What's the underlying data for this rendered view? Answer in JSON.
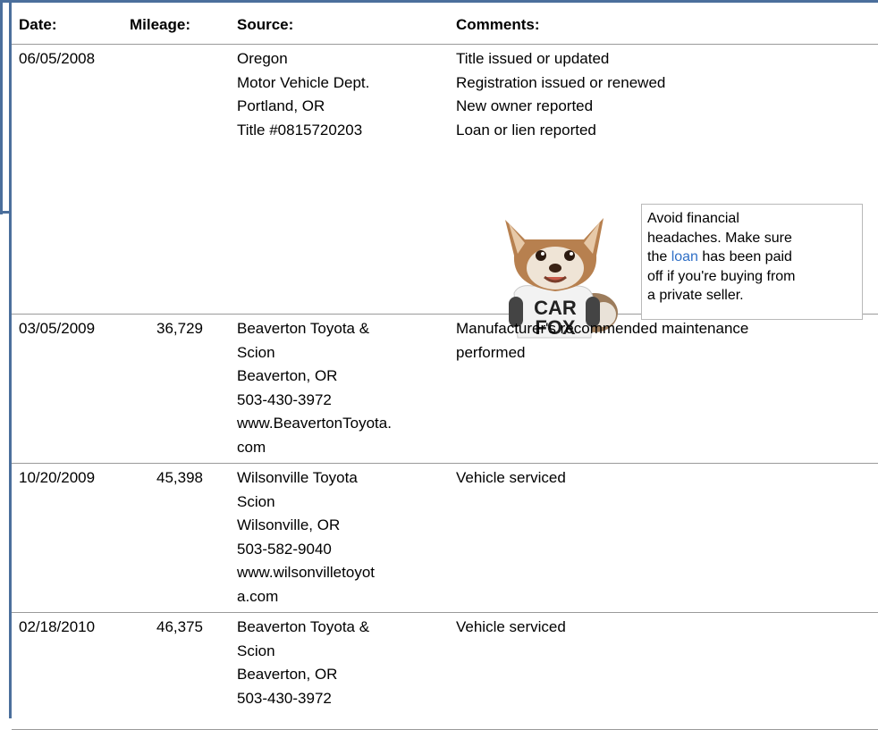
{
  "header": {
    "date": "Date:",
    "mileage": "Mileage:",
    "source": "Source:",
    "comments": "Comments:"
  },
  "rows": [
    {
      "date": "06/05/2008",
      "mileage": "",
      "source": [
        "Oregon",
        "Motor Vehicle Dept.",
        "Portland, OR",
        "Title #0815720203"
      ],
      "comments": [
        "Title issued or updated",
        "Registration issued or renewed",
        "New owner reported",
        "Loan or lien reported"
      ]
    },
    {
      "date": "03/05/2009",
      "mileage": "36,729",
      "source": [
        "Beaverton Toyota &",
        "Scion",
        "Beaverton, OR",
        "503-430-3972",
        "www.BeavertonToyota.",
        "com"
      ],
      "comments": [
        "Manufacturer's recommended maintenance",
        "performed"
      ]
    },
    {
      "date": "10/20/2009",
      "mileage": "45,398",
      "source": [
        "Wilsonville Toyota",
        "Scion",
        "Wilsonville, OR",
        "503-582-9040",
        "www.wilsonvilletoyot",
        "a.com"
      ],
      "comments": [
        "Vehicle serviced"
      ]
    },
    {
      "date": "02/18/2010",
      "mileage": "46,375",
      "source": [
        "Beaverton Toyota &",
        "Scion",
        "Beaverton, OR",
        "503-430-3972"
      ],
      "comments": [
        "Vehicle serviced"
      ]
    }
  ],
  "tip": {
    "line1": "Avoid financial",
    "line2": "headaches. Make sure",
    "line3_pre": "the ",
    "link": "loan",
    "line3_post": " has been paid",
    "line4": "off if you're buying from",
    "line5": "a private seller."
  },
  "mascot": {
    "shirt_line1": "CAR",
    "shirt_line2": "FOX"
  }
}
